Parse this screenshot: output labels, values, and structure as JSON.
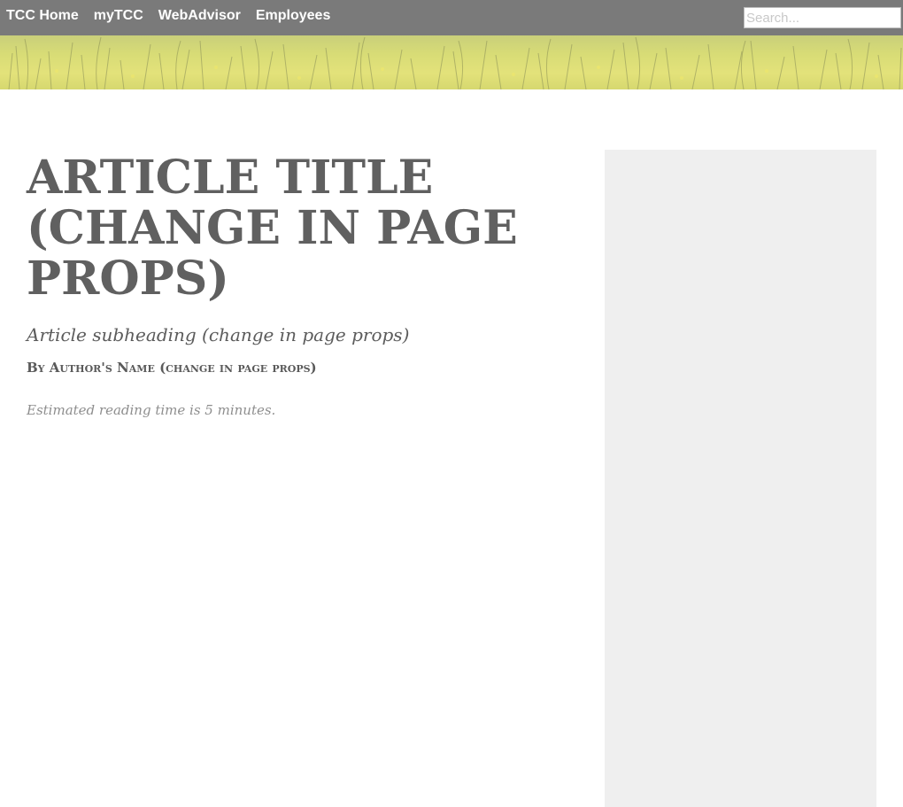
{
  "nav": {
    "links": [
      "TCC Home",
      "myTCC",
      "WebAdvisor",
      "Employees"
    ],
    "search_placeholder": "Search..."
  },
  "article": {
    "title": "Article Title (change in page props)",
    "subheading": "Article subheading (change in page props)",
    "byline": "By Author's Name (change in page props)",
    "reading_time": "Estimated reading time is 5 minutes."
  },
  "colors": {
    "nav_bg": "#7a7a7a",
    "sidebar_bg": "#efefef",
    "title_text": "#606060"
  }
}
